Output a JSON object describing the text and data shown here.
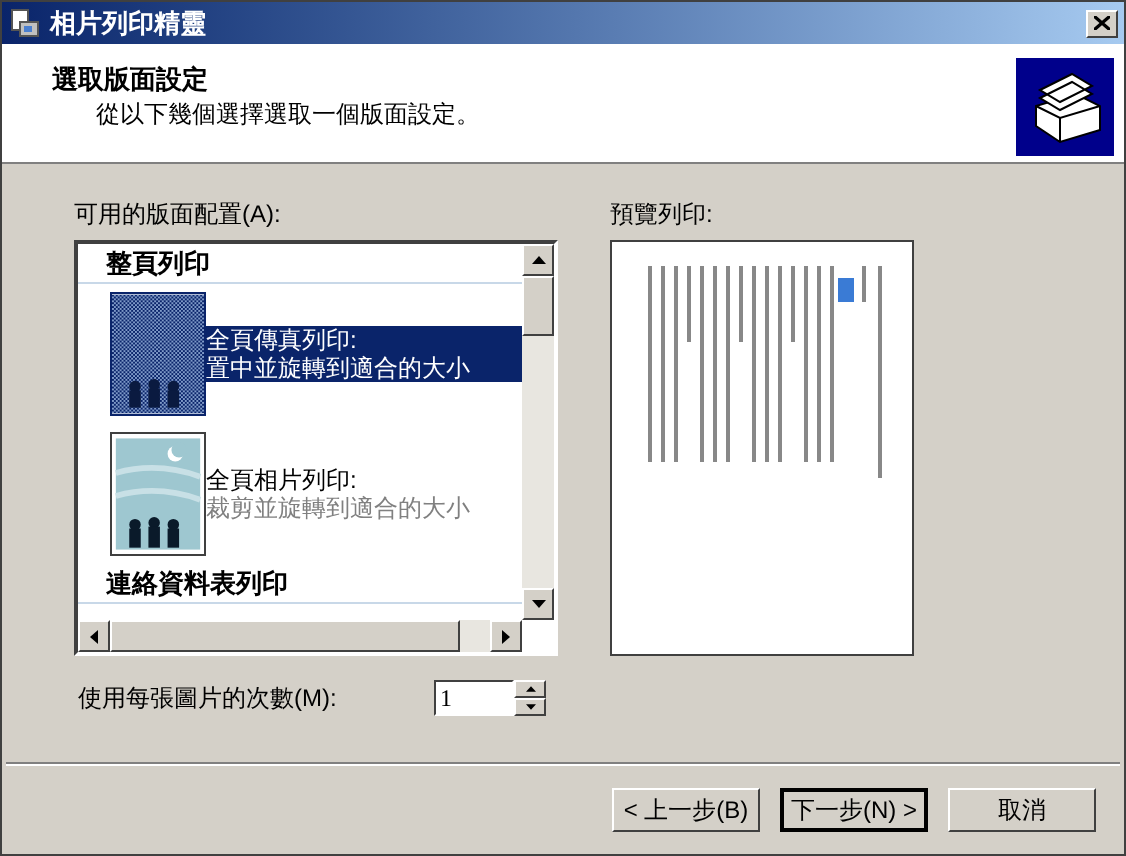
{
  "window": {
    "title": "相片列印精靈"
  },
  "header": {
    "title": "選取版面設定",
    "subtitle": "從以下幾個選擇選取一個版面設定。"
  },
  "layouts": {
    "label": "可用的版面配置(A):",
    "groups": [
      {
        "title": "整頁列印",
        "items": [
          {
            "kind": "fax",
            "line1": "全頁傳真列印:",
            "line2": "置中並旋轉到適合的大小",
            "selected": true
          },
          {
            "kind": "photo",
            "line1": "全頁相片列印:",
            "line2": "裁剪並旋轉到適合的大小",
            "selected": false
          }
        ]
      },
      {
        "title": "連絡資料表列印"
      }
    ]
  },
  "preview": {
    "label": "預覽列印:"
  },
  "copies": {
    "label": "使用每張圖片的次數(M):",
    "value": "1"
  },
  "buttons": [
    {
      "label": "< 上一步(B)",
      "default": false
    },
    {
      "label": "下一步(N) >",
      "default": true
    },
    {
      "label": "取消",
      "default": false
    }
  ]
}
